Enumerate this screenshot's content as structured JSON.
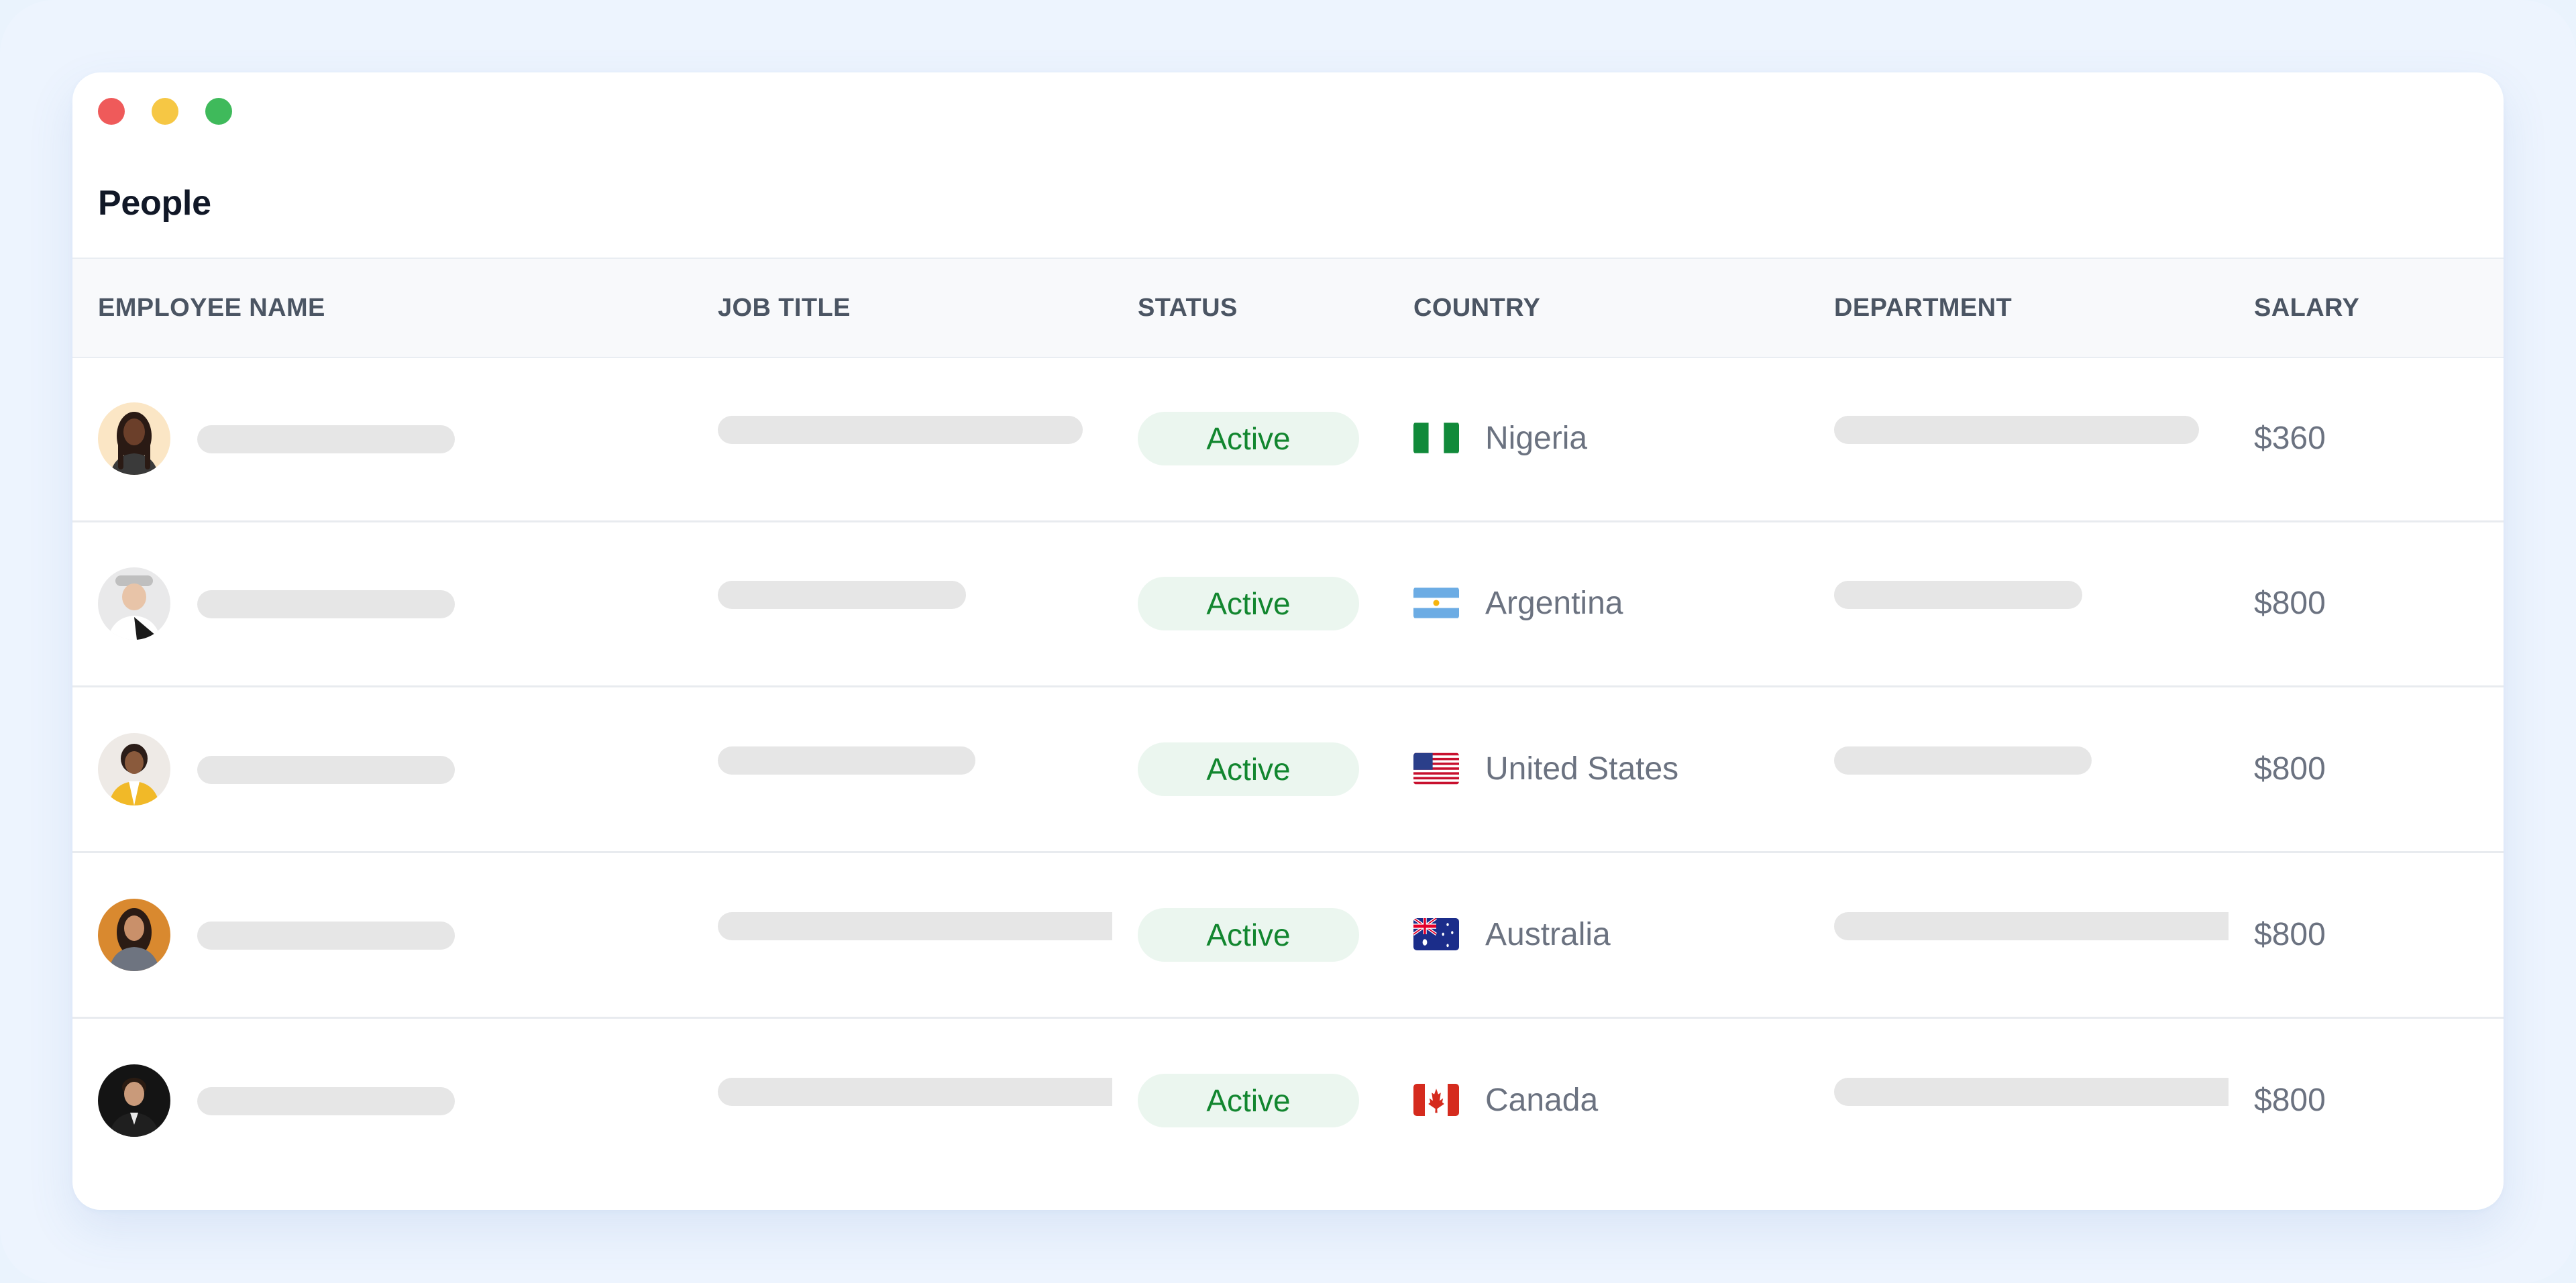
{
  "window": {
    "title": "People"
  },
  "table": {
    "columns": [
      "EMPLOYEE NAME",
      "JOB TITLE",
      "STATUS",
      "COUNTRY",
      "DEPARTMENT",
      "SALARY"
    ],
    "rows": [
      {
        "avatar": "woman-braids-avatar",
        "status": "Active",
        "country": "Nigeria",
        "flag": "nigeria-flag-icon",
        "salary": "$360"
      },
      {
        "avatar": "man-cap-avatar",
        "status": "Active",
        "country": "Argentina",
        "flag": "argentina-flag-icon",
        "salary": "$800"
      },
      {
        "avatar": "woman-yellow-jacket-avatar",
        "status": "Active",
        "country": "United States",
        "flag": "usa-flag-icon",
        "salary": "$800"
      },
      {
        "avatar": "woman-long-hair-avatar",
        "status": "Active",
        "country": "Australia",
        "flag": "australia-flag-icon",
        "salary": "$800"
      },
      {
        "avatar": "man-dark-suit-avatar",
        "status": "Active",
        "country": "Canada",
        "flag": "canada-flag-icon",
        "salary": "$800"
      }
    ]
  },
  "colors": {
    "background": "#edf4fe",
    "status_active_bg": "#ebf6ef",
    "status_active_text": "#12862f",
    "placeholder_bar": "#e6e6e6"
  }
}
